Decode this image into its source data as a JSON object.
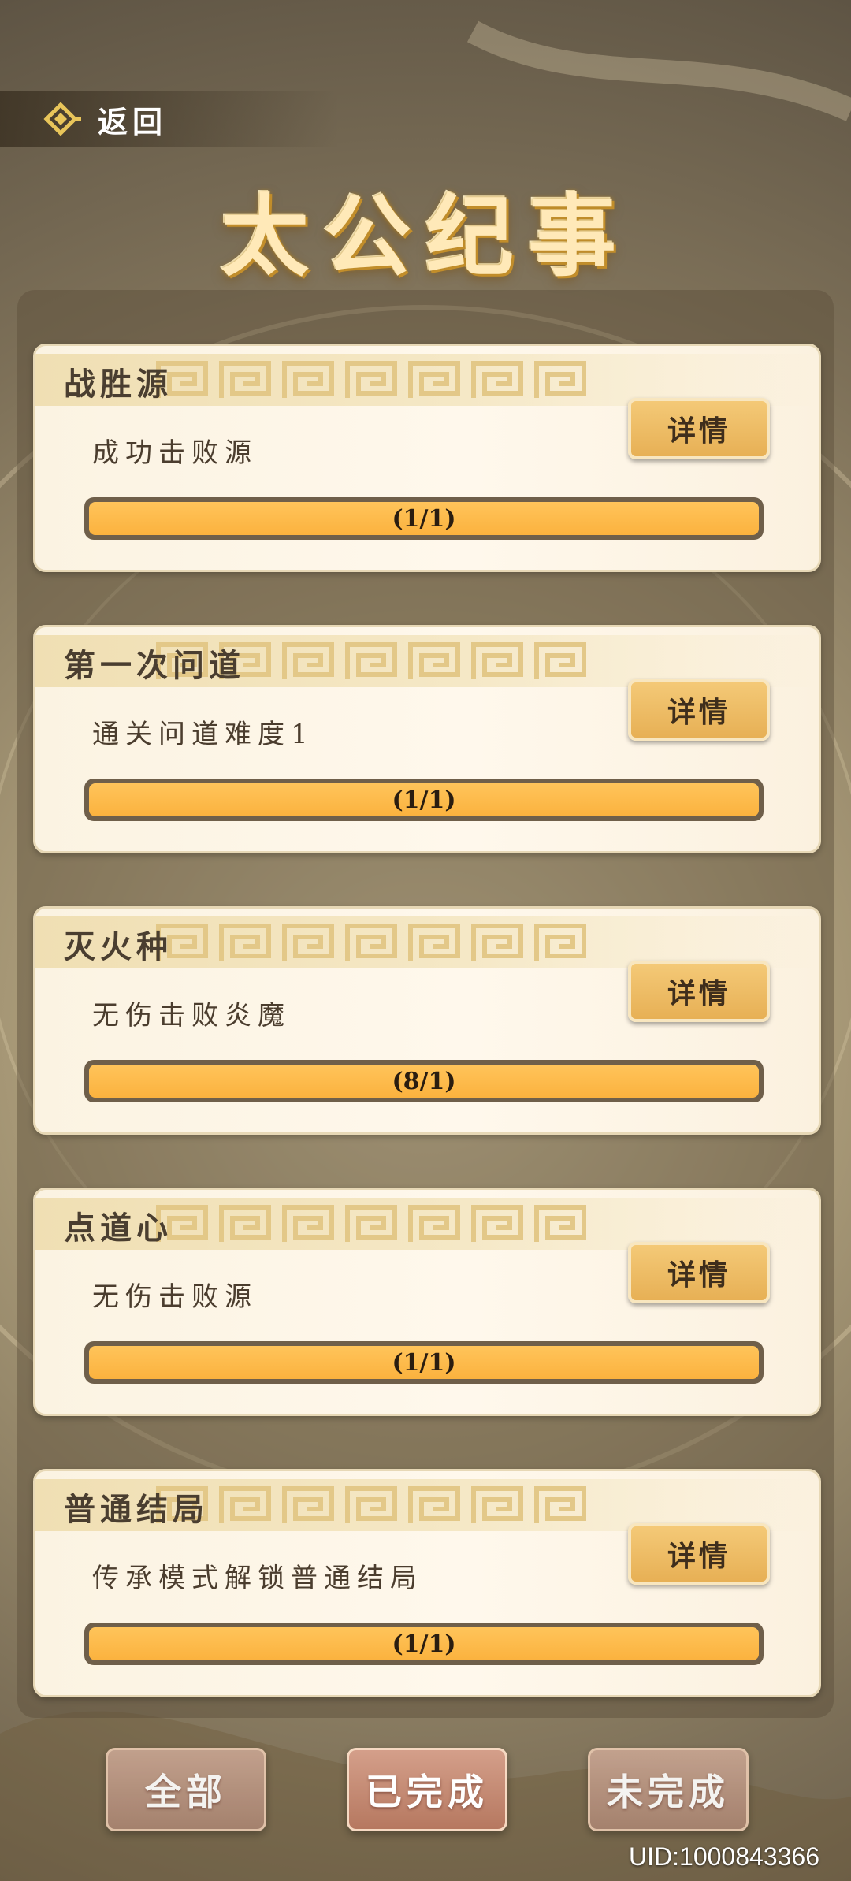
{
  "header": {
    "back_label": "返回",
    "title": "太公纪事"
  },
  "detail_label": "详情",
  "achievements": [
    {
      "title": "战胜源",
      "description": "成功击败源",
      "progress_text": "(1/1)",
      "progress": 1.0
    },
    {
      "title": "第一次问道",
      "description": "通关问道难度1",
      "progress_text": "(1/1)",
      "progress": 1.0
    },
    {
      "title": "灭火种",
      "description": "无伤击败炎魔",
      "progress_text": "(8/1)",
      "progress": 1.0
    },
    {
      "title": "点道心",
      "description": "无伤击败源",
      "progress_text": "(1/1)",
      "progress": 1.0
    },
    {
      "title": "普通结局",
      "description": "传承模式解锁普通结局",
      "progress_text": "(1/1)",
      "progress": 1.0
    }
  ],
  "tabs": {
    "all": "全部",
    "completed": "已完成",
    "incomplete": "未完成",
    "selected": "已完成"
  },
  "uid_text": "UID:1000843366",
  "colors": {
    "progress_fill": "#fbb23e",
    "button": "#e7b055",
    "title_glow": "#c58f2c"
  }
}
